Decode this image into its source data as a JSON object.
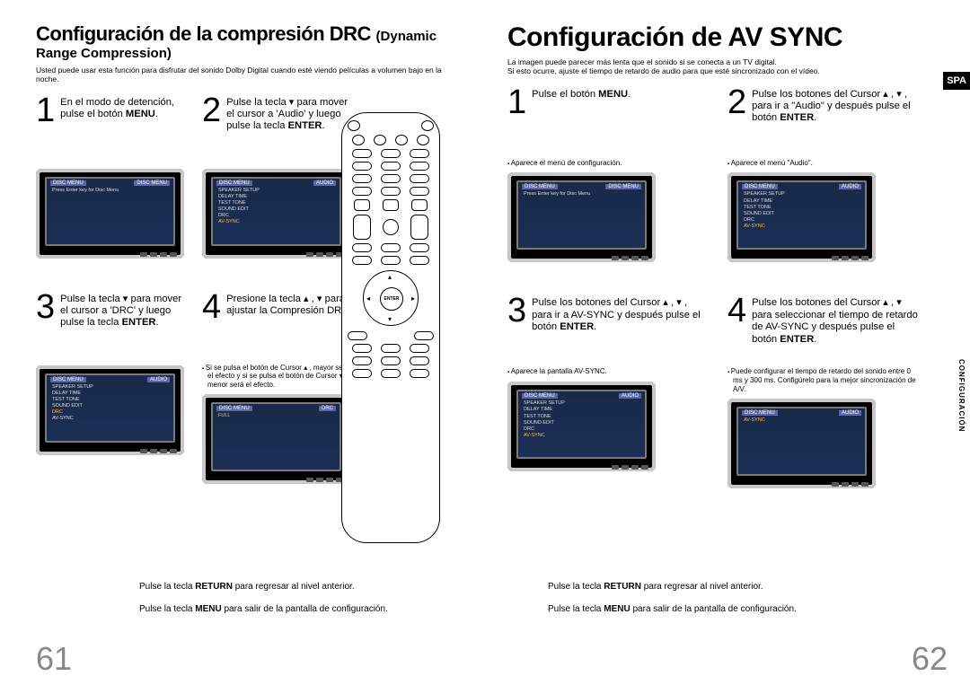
{
  "left": {
    "title_main": "Configuración de la compresión DRC ",
    "title_sub": "(Dynamic Range Compression)",
    "intro": "Usted puede usar esta función para disfrutar del sonido Dolby Digital cuando esté viendo películas a volumen bajo en la noche.",
    "steps": [
      {
        "num": "1",
        "text_pre": "En el modo de detención, pulse el botón ",
        "bold1": "MENU",
        "text_post": ".",
        "note": ""
      },
      {
        "num": "2",
        "text_pre": "Pulse la tecla ▾ para mover el cursor a 'Audio' y luego pulse la tecla ",
        "bold1": "ENTER",
        "text_post": ".",
        "note": ""
      },
      {
        "num": "3",
        "text_pre": "Pulse la tecla ▾ para mover el cursor a 'DRC' y luego pulse la tecla ",
        "bold1": "ENTER",
        "text_post": ".",
        "note": ""
      },
      {
        "num": "4",
        "text_pre": "Presione la tecla ▴ , ▾ para ajustar la Compresión DRC.",
        "bold1": "",
        "text_post": "",
        "note": "Si se pulsa el botón de Cursor ▴ , mayor será el efecto y si se pulsa el botón de Cursor ▾ , menor será el efecto."
      }
    ],
    "footer1_pre": "Pulse la tecla ",
    "footer1_bold": "RETURN",
    "footer1_post": " para regresar al nivel anterior.",
    "footer2_pre": "Pulse la tecla ",
    "footer2_bold": "MENU",
    "footer2_post": " para salir de la pantalla de configuración.",
    "page_num": "61"
  },
  "right": {
    "title": "Configuración de AV SYNC",
    "intro": "La imagen puede parecer más lenta que el sonido si se conecta a un TV digital.\nSi esto ocurre, ajuste el tiempo de retardo de audio para que esté sincronizado con el vídeo.",
    "spa": "SPA",
    "side": "CONFIGURACIÓN",
    "steps": [
      {
        "num": "1",
        "text_pre": "Pulse el botón ",
        "bold1": "MENU",
        "text_post": ".",
        "note": "Aparece el menú de configuración."
      },
      {
        "num": "2",
        "text_pre": "Pulse los botones del Cursor ▴ , ▾ , para ir a \"Audio\" y después pulse el botón ",
        "bold1": "ENTER",
        "text_post": ".",
        "note": "Aparece el menú \"Audio\"."
      },
      {
        "num": "3",
        "text_pre": "Pulse los botones del Cursor ▴ , ▾ , para ir a AV-SYNC y después pulse el botón ",
        "bold1": "ENTER",
        "text_post": ".",
        "note": "Aparece la pantalla AV-SYNC."
      },
      {
        "num": "4",
        "text_pre": "Pulse los botones del Cursor ▴ , ▾ para seleccionar el tiempo de retardo de AV-SYNC y después pulse el botón ",
        "bold1": "ENTER",
        "text_post": ".",
        "note": "Puede configurar el tiempo de retardo del sonido entre 0 ms y 300 ms. Configúrelo para la mejor sincronización de A/V."
      }
    ],
    "footer1_pre": "Pulse la tecla ",
    "footer1_bold": "RETURN",
    "footer1_post": " para regresar al nivel anterior.",
    "footer2_pre": "Pulse la tecla ",
    "footer2_bold": "MENU",
    "footer2_post": " para salir de la pantalla de configuración.",
    "page_num": "62"
  },
  "tv_menus": {
    "disc_menu": "DISC MENU",
    "audio": "AUDIO",
    "press_enter": "Press Enter key for Disc Menu",
    "items": [
      "SPEAKER SETUP",
      "DELAY TIME",
      "TEST TONE",
      "SOUND EDIT",
      "DRC",
      "AV-SYNC"
    ],
    "drc": "DRC",
    "avsync": "AV-SYNC",
    "full": "FULL"
  },
  "remote": {
    "enter": "ENTER"
  }
}
